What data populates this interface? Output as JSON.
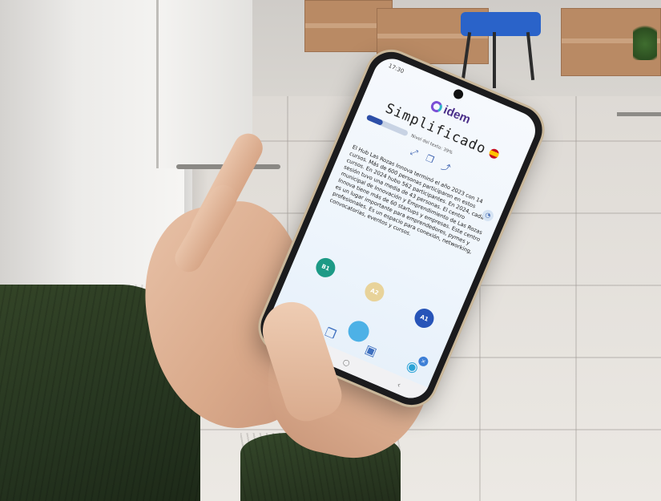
{
  "phone": {
    "status": {
      "time": "17:30",
      "right": ""
    },
    "app": {
      "logo_text": "idem",
      "title": "Simplificado",
      "level_label": "Nivel del texto: 39%",
      "level_percent": 39,
      "tools": {
        "expand": "⤢",
        "copy": "❐",
        "share": "⤴"
      },
      "body": "El Hub Las Rozas Innova terminó el año 2023 con 14 cursos. Más de 600 personas participaron en estos cursos. En 2024 hubo 562 participantes. En 2024, cada sesión tuvo una media de 43 personas. El centro municipal de Innovación y Emprendimiento de Las Rozas Innova tiene más de 60 startups y empresas. Este centro es un lugar importante para emprendedores, pymes y profesionales. Es un espacio para conexión, networking, convocatorias, eventos y cursos.",
      "levels": {
        "b1": "B1",
        "a2": "A2",
        "a1": "A1"
      },
      "side_button": "◔",
      "close": "×",
      "nav": {
        "home": "⌂",
        "notes": "❐",
        "gallery": "▣",
        "camera": "◉"
      },
      "sysnav": {
        "menu": "≡",
        "home": "○",
        "back": "‹"
      }
    }
  }
}
